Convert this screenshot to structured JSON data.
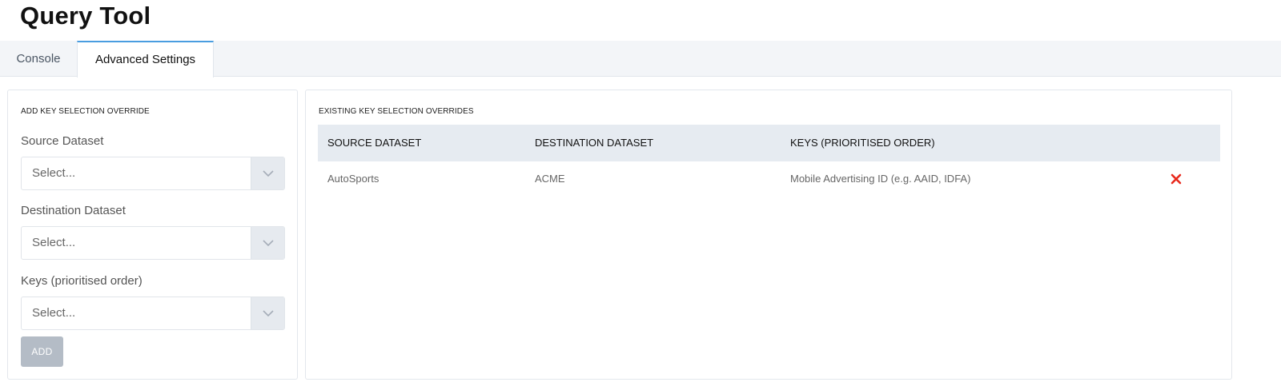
{
  "app": {
    "title": "Query Tool"
  },
  "tabs": [
    {
      "label": "Console",
      "active": false
    },
    {
      "label": "Advanced Settings",
      "active": true
    }
  ],
  "add_panel": {
    "heading": "ADD KEY SELECTION OVERRIDE",
    "fields": [
      {
        "label": "Source Dataset",
        "value": "Select..."
      },
      {
        "label": "Destination Dataset",
        "value": "Select..."
      },
      {
        "label": "Keys (prioritised order)",
        "value": "Select..."
      }
    ],
    "add_label": "ADD"
  },
  "existing_panel": {
    "heading": "EXISTING KEY SELECTION OVERRIDES",
    "columns": [
      "SOURCE DATASET",
      "DESTINATION DATASET",
      "KEYS (PRIORITISED ORDER)"
    ],
    "rows": [
      {
        "source": "AutoSports",
        "destination": "ACME",
        "keys": "Mobile Advertising ID (e.g. AAID, IDFA)"
      }
    ]
  },
  "colors": {
    "accent": "#4a9de0",
    "delete": "#e8291c",
    "button_disabled": "#b4bcc6"
  }
}
